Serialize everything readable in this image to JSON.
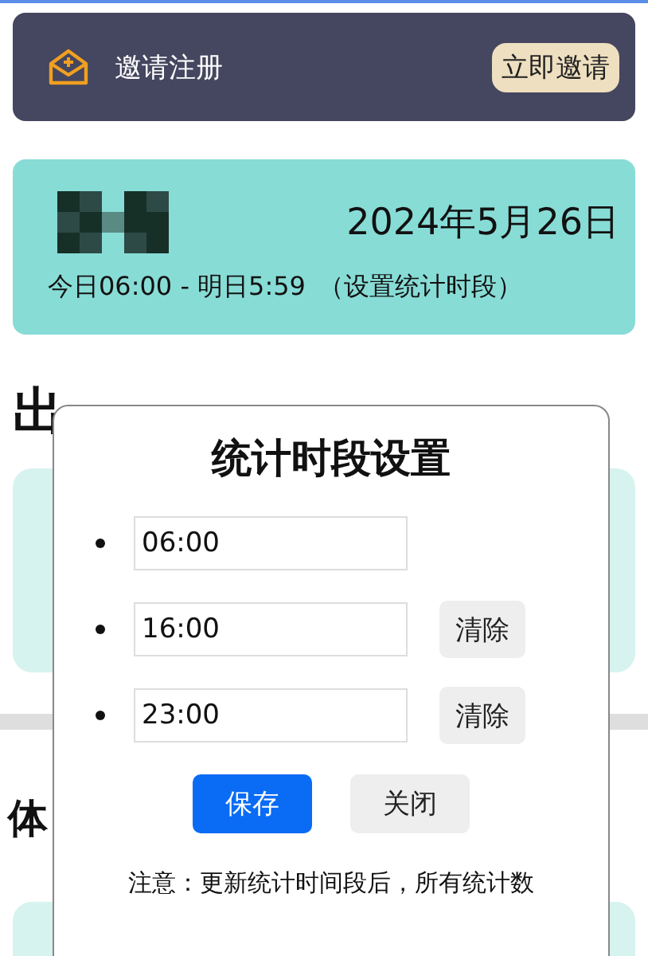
{
  "banner": {
    "label": "邀请注册",
    "button": "立即邀请"
  },
  "summary": {
    "date": "2024年5月26日",
    "period": "今日06:00 - 明日5:59",
    "link": "（设置统计时段）"
  },
  "sections": [
    {
      "heading": "出"
    },
    {
      "heading": "体"
    }
  ],
  "dialog": {
    "title": "统计时段设置",
    "slots": [
      {
        "value": "06:00"
      },
      {
        "value": "16:00",
        "clear_button": "清除"
      },
      {
        "value": "23:00",
        "clear_button": "清除"
      }
    ],
    "buttons": [
      {
        "label": "保存",
        "kind": "primary"
      },
      {
        "label": "关闭",
        "kind": "secondary"
      }
    ],
    "note": "注意：更新统计时间段后，所有统计数"
  }
}
